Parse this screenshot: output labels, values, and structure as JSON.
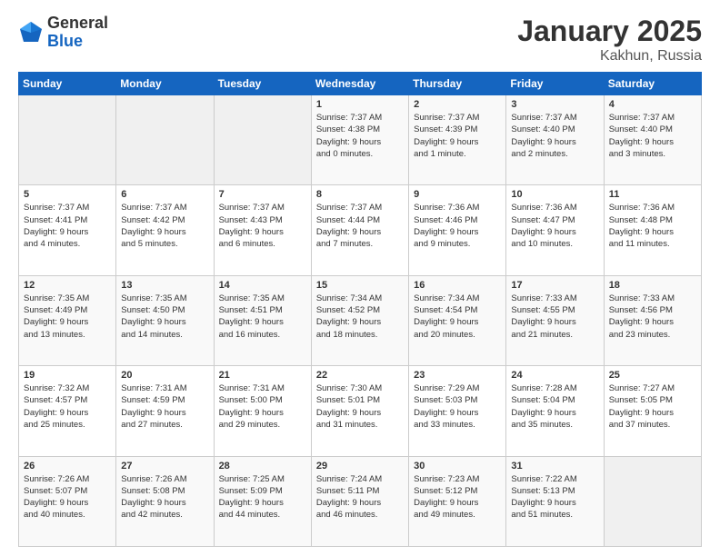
{
  "logo": {
    "general": "General",
    "blue": "Blue"
  },
  "title": "January 2025",
  "location": "Kakhun, Russia",
  "days_of_week": [
    "Sunday",
    "Monday",
    "Tuesday",
    "Wednesday",
    "Thursday",
    "Friday",
    "Saturday"
  ],
  "weeks": [
    [
      {
        "day": "",
        "info": ""
      },
      {
        "day": "",
        "info": ""
      },
      {
        "day": "",
        "info": ""
      },
      {
        "day": "1",
        "info": "Sunrise: 7:37 AM\nSunset: 4:38 PM\nDaylight: 9 hours\nand 0 minutes."
      },
      {
        "day": "2",
        "info": "Sunrise: 7:37 AM\nSunset: 4:39 PM\nDaylight: 9 hours\nand 1 minute."
      },
      {
        "day": "3",
        "info": "Sunrise: 7:37 AM\nSunset: 4:40 PM\nDaylight: 9 hours\nand 2 minutes."
      },
      {
        "day": "4",
        "info": "Sunrise: 7:37 AM\nSunset: 4:40 PM\nDaylight: 9 hours\nand 3 minutes."
      }
    ],
    [
      {
        "day": "5",
        "info": "Sunrise: 7:37 AM\nSunset: 4:41 PM\nDaylight: 9 hours\nand 4 minutes."
      },
      {
        "day": "6",
        "info": "Sunrise: 7:37 AM\nSunset: 4:42 PM\nDaylight: 9 hours\nand 5 minutes."
      },
      {
        "day": "7",
        "info": "Sunrise: 7:37 AM\nSunset: 4:43 PM\nDaylight: 9 hours\nand 6 minutes."
      },
      {
        "day": "8",
        "info": "Sunrise: 7:37 AM\nSunset: 4:44 PM\nDaylight: 9 hours\nand 7 minutes."
      },
      {
        "day": "9",
        "info": "Sunrise: 7:36 AM\nSunset: 4:46 PM\nDaylight: 9 hours\nand 9 minutes."
      },
      {
        "day": "10",
        "info": "Sunrise: 7:36 AM\nSunset: 4:47 PM\nDaylight: 9 hours\nand 10 minutes."
      },
      {
        "day": "11",
        "info": "Sunrise: 7:36 AM\nSunset: 4:48 PM\nDaylight: 9 hours\nand 11 minutes."
      }
    ],
    [
      {
        "day": "12",
        "info": "Sunrise: 7:35 AM\nSunset: 4:49 PM\nDaylight: 9 hours\nand 13 minutes."
      },
      {
        "day": "13",
        "info": "Sunrise: 7:35 AM\nSunset: 4:50 PM\nDaylight: 9 hours\nand 14 minutes."
      },
      {
        "day": "14",
        "info": "Sunrise: 7:35 AM\nSunset: 4:51 PM\nDaylight: 9 hours\nand 16 minutes."
      },
      {
        "day": "15",
        "info": "Sunrise: 7:34 AM\nSunset: 4:52 PM\nDaylight: 9 hours\nand 18 minutes."
      },
      {
        "day": "16",
        "info": "Sunrise: 7:34 AM\nSunset: 4:54 PM\nDaylight: 9 hours\nand 20 minutes."
      },
      {
        "day": "17",
        "info": "Sunrise: 7:33 AM\nSunset: 4:55 PM\nDaylight: 9 hours\nand 21 minutes."
      },
      {
        "day": "18",
        "info": "Sunrise: 7:33 AM\nSunset: 4:56 PM\nDaylight: 9 hours\nand 23 minutes."
      }
    ],
    [
      {
        "day": "19",
        "info": "Sunrise: 7:32 AM\nSunset: 4:57 PM\nDaylight: 9 hours\nand 25 minutes."
      },
      {
        "day": "20",
        "info": "Sunrise: 7:31 AM\nSunset: 4:59 PM\nDaylight: 9 hours\nand 27 minutes."
      },
      {
        "day": "21",
        "info": "Sunrise: 7:31 AM\nSunset: 5:00 PM\nDaylight: 9 hours\nand 29 minutes."
      },
      {
        "day": "22",
        "info": "Sunrise: 7:30 AM\nSunset: 5:01 PM\nDaylight: 9 hours\nand 31 minutes."
      },
      {
        "day": "23",
        "info": "Sunrise: 7:29 AM\nSunset: 5:03 PM\nDaylight: 9 hours\nand 33 minutes."
      },
      {
        "day": "24",
        "info": "Sunrise: 7:28 AM\nSunset: 5:04 PM\nDaylight: 9 hours\nand 35 minutes."
      },
      {
        "day": "25",
        "info": "Sunrise: 7:27 AM\nSunset: 5:05 PM\nDaylight: 9 hours\nand 37 minutes."
      }
    ],
    [
      {
        "day": "26",
        "info": "Sunrise: 7:26 AM\nSunset: 5:07 PM\nDaylight: 9 hours\nand 40 minutes."
      },
      {
        "day": "27",
        "info": "Sunrise: 7:26 AM\nSunset: 5:08 PM\nDaylight: 9 hours\nand 42 minutes."
      },
      {
        "day": "28",
        "info": "Sunrise: 7:25 AM\nSunset: 5:09 PM\nDaylight: 9 hours\nand 44 minutes."
      },
      {
        "day": "29",
        "info": "Sunrise: 7:24 AM\nSunset: 5:11 PM\nDaylight: 9 hours\nand 46 minutes."
      },
      {
        "day": "30",
        "info": "Sunrise: 7:23 AM\nSunset: 5:12 PM\nDaylight: 9 hours\nand 49 minutes."
      },
      {
        "day": "31",
        "info": "Sunrise: 7:22 AM\nSunset: 5:13 PM\nDaylight: 9 hours\nand 51 minutes."
      },
      {
        "day": "",
        "info": ""
      }
    ]
  ]
}
